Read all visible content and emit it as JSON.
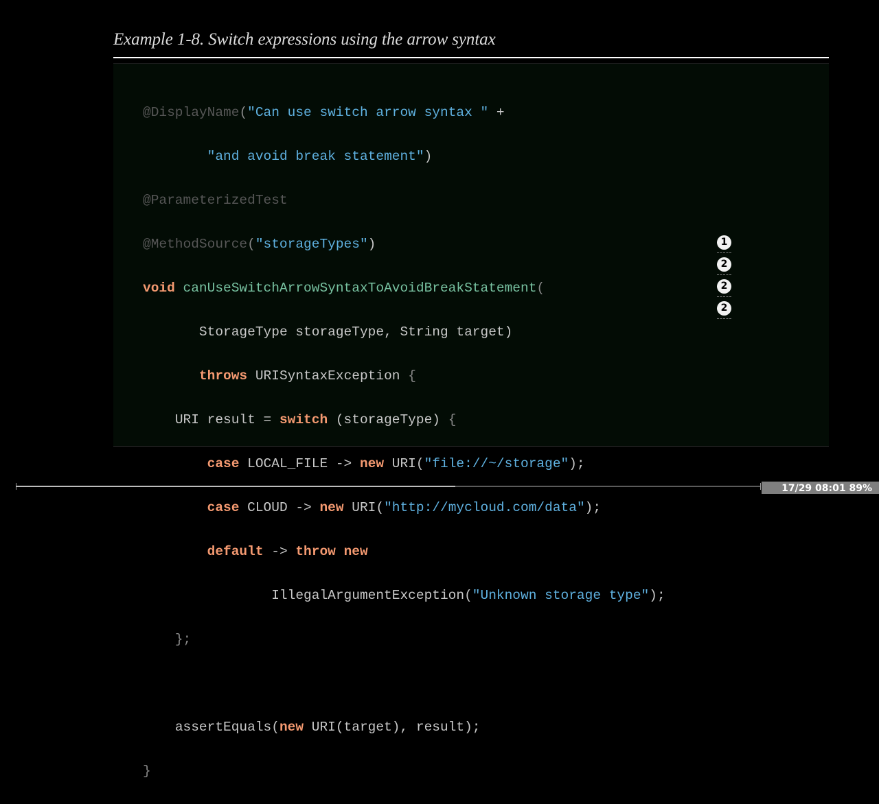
{
  "caption": "Example 1-8. Switch expressions using the arrow syntax",
  "code": {
    "l1": {
      "a": "@DisplayName",
      "b": "(",
      "c": "\"Can use switch arrow syntax \"",
      "d": " +"
    },
    "l2": {
      "indent": "        ",
      "a": "\"and avoid break statement\"",
      "b": ")"
    },
    "l3": {
      "a": "@ParameterizedTest"
    },
    "l4": {
      "a": "@MethodSource",
      "b": "(",
      "c": "\"storageTypes\"",
      "d": ")"
    },
    "l5": {
      "kw": "void",
      "sp": " ",
      "a": "canUseSwitchArrowSyntaxToAvoidBreakStatement",
      "b": "("
    },
    "l6": {
      "indent": "       ",
      "a": "StorageType storageType, String target)"
    },
    "l7": {
      "indent": "       ",
      "kw": "throws",
      "a": " URISyntaxException ",
      "b": "{"
    },
    "l8": {
      "indent": "    ",
      "a": "URI result = ",
      "kw": "switch",
      "b": " (storageType) ",
      "c": "{"
    },
    "l9": {
      "indent": "        ",
      "kw": "case",
      "a": " LOCAL_FILE -> ",
      "kw2": "new",
      "b": " URI(",
      "c": "\"file://~/storage\"",
      "d": ");"
    },
    "l10": {
      "indent": "        ",
      "kw": "case",
      "a": " CLOUD -> ",
      "kw2": "new",
      "b": " URI(",
      "c": "\"http://mycloud.com/data\"",
      "d": ");"
    },
    "l11": {
      "indent": "        ",
      "kw": "default",
      "a": " -> ",
      "kw2": "throw",
      "sp": " ",
      "kw3": "new"
    },
    "l12": {
      "indent": "                ",
      "a": "IllegalArgumentException(",
      "c": "\"Unknown storage type\"",
      "d": ");"
    },
    "l13": {
      "indent": "    ",
      "a": "};"
    },
    "l14": {
      "a": ""
    },
    "l15": {
      "indent": "    ",
      "a": "assertEquals(",
      "kw": "new",
      "b": " URI(target), result);"
    },
    "l16": {
      "a": "}"
    }
  },
  "callouts": [
    "1",
    "2",
    "2",
    "2"
  ],
  "status": {
    "text": "17/29  08:01  89%",
    "progress": 0.59
  }
}
